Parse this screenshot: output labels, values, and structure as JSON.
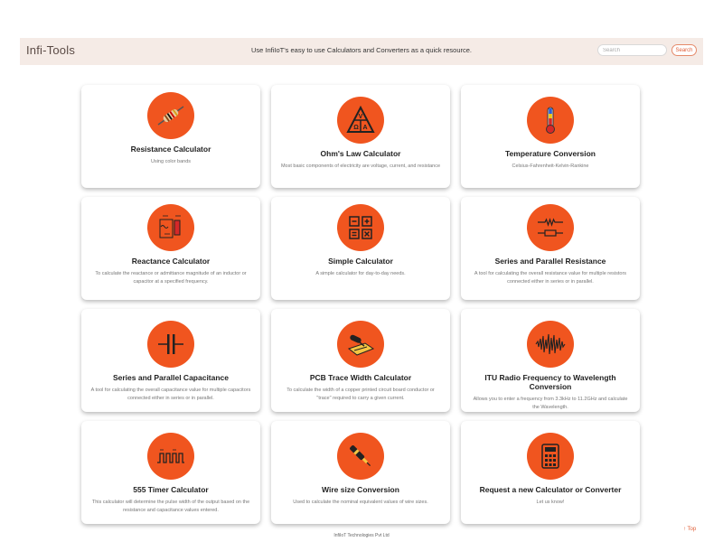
{
  "navbar": {
    "brand": "Infi-Tools",
    "tagline": "Use InfiIoT's easy to use Calculators and Converters as a quick resource.",
    "search_placeholder": "Search",
    "search_button": "Search"
  },
  "cards": [
    {
      "title": "Resistance Calculator",
      "desc": "Using color bands",
      "icon": "resistor-icon"
    },
    {
      "title": "Ohm's Law Calculator",
      "desc": "Most basic components of electricity are voltage, current, and resistance",
      "icon": "ohms-law-triangle-icon"
    },
    {
      "title": "Temperature Conversion",
      "desc": "Celsius-Fahrenheit-Kelvin-Rankine",
      "icon": "thermometer-icon"
    },
    {
      "title": "Reactance Calculator",
      "desc": "To calculate the reactance or admittance magnitude of an inductor or capacitor at a specified frequency.",
      "icon": "reactance-circuit-icon"
    },
    {
      "title": "Simple Calculator",
      "desc": "A simple calculator for day-to-day needs.",
      "icon": "calculator-keys-icon"
    },
    {
      "title": "Series and Parallel Resistance",
      "desc": "A tool for calculating the overall resistance value for multiple resistors connected either in series or in parallel.",
      "icon": "resistor-network-icon"
    },
    {
      "title": "Series and Parallel Capacitance",
      "desc": "A tool for calculating the overall capacitance value for multiple capacitors connected either in series or in parallel.",
      "icon": "capacitor-icon"
    },
    {
      "title": "PCB Trace Width Calculator",
      "desc": "To calculate the width of a copper printed circuit board conductor or \"trace\" required to carry a given current.",
      "icon": "pcb-trace-icon"
    },
    {
      "title": "ITU Radio Frequency to Wavelength Conversion",
      "desc": "Allows you to enter a frequency from 3.3kHz to 11.2GHz and calculate the Wavelength.",
      "icon": "radio-wave-icon"
    },
    {
      "title": "555 Timer Calculator",
      "desc": "This calculator will determine the pulse width of the output based on the resistance and capacitance values entered.",
      "icon": "square-wave-icon"
    },
    {
      "title": "Wire size Conversion",
      "desc": "Used to calculate the nominal equivalent values of wire sizes.",
      "icon": "wire-icon"
    },
    {
      "title": "Request a new Calculator or Converter",
      "desc": "Let us know!",
      "icon": "calculator-request-icon"
    }
  ],
  "footer": {
    "copyright": "InfiIoT Technologies Pvt Ltd",
    "top_link": "↑ Top"
  }
}
